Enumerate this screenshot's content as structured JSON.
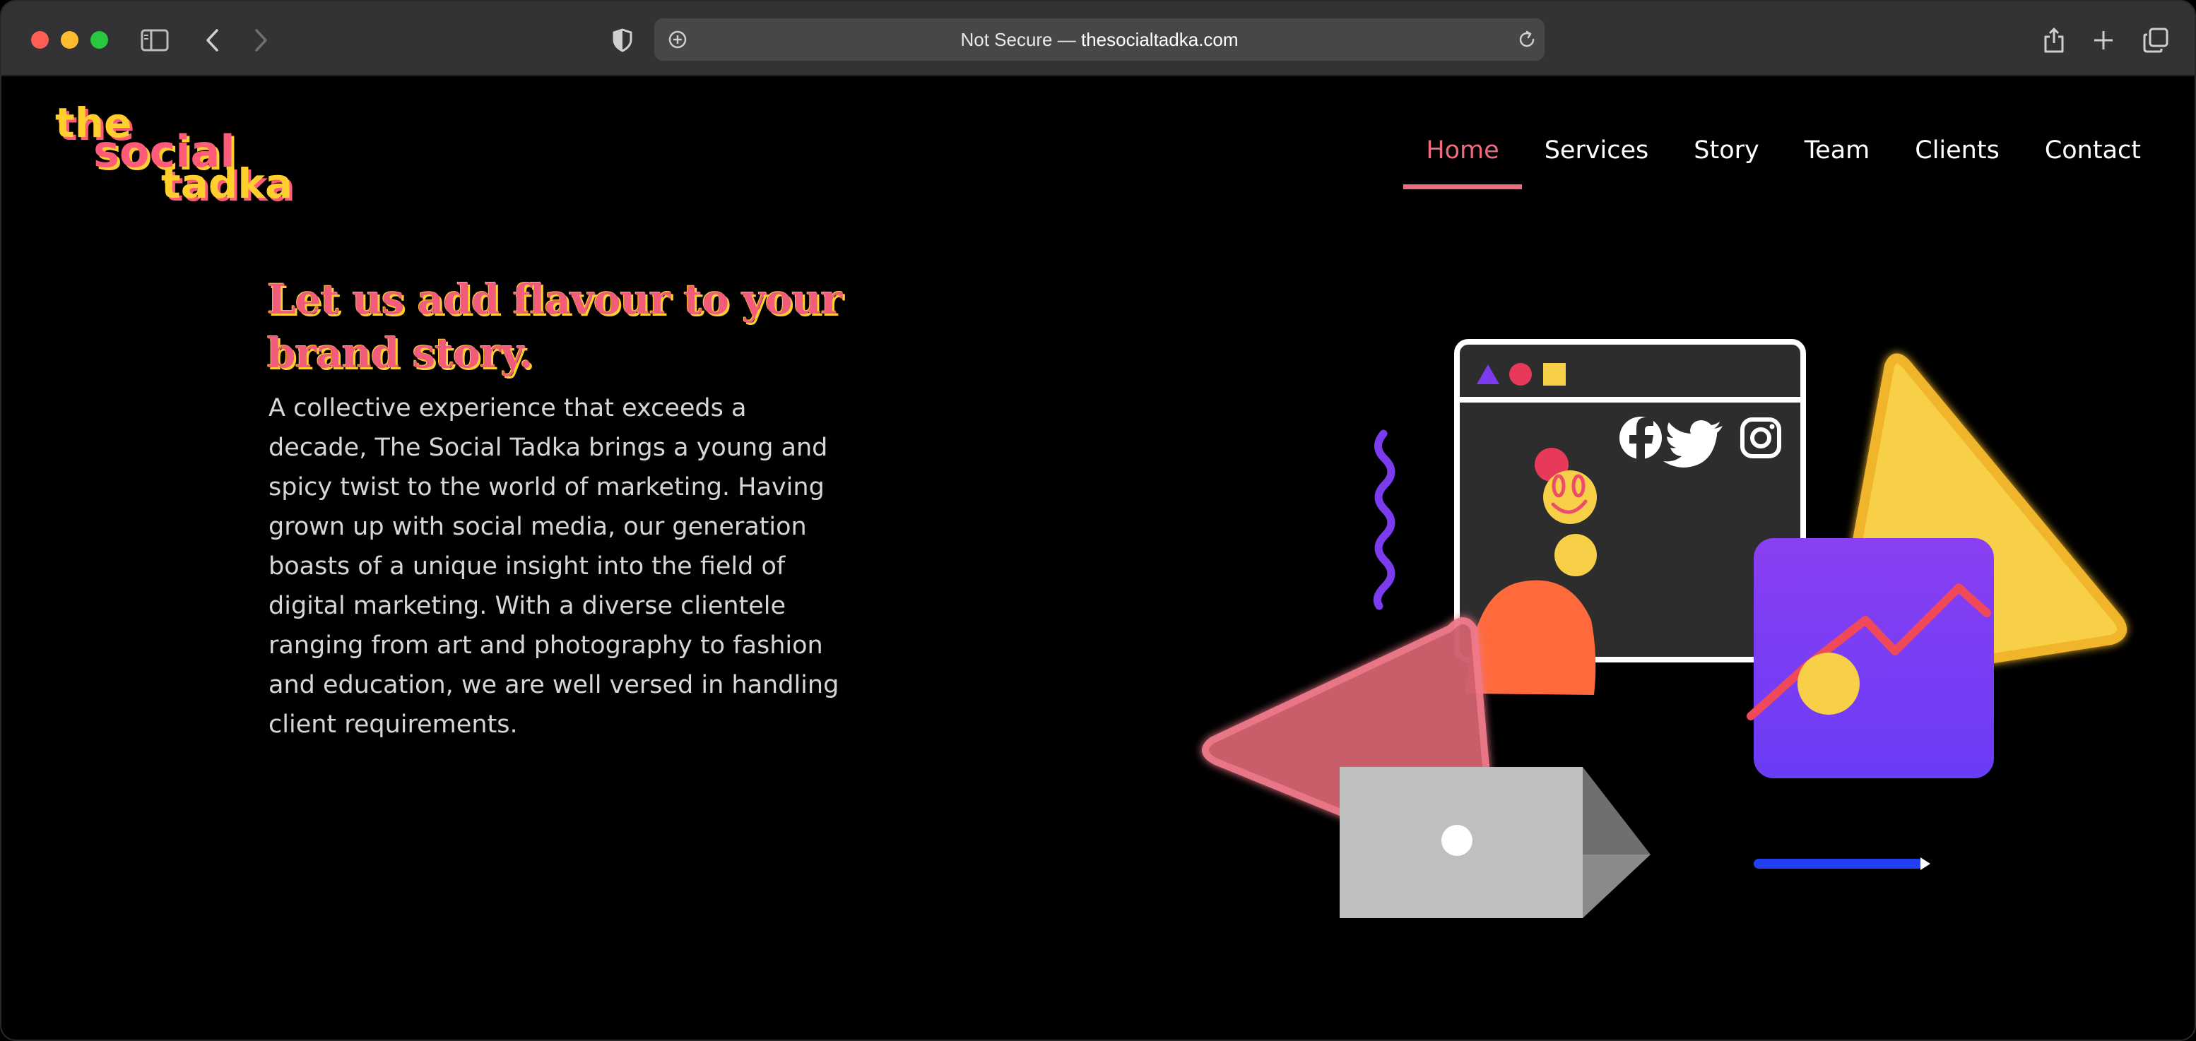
{
  "browser": {
    "url_prefix": "Not Secure — ",
    "url_domain": "thesocialtadka.com"
  },
  "logo": {
    "line1": "the",
    "line2": "social",
    "line3": "tadka"
  },
  "nav": {
    "items": [
      {
        "label": "Home",
        "active": true
      },
      {
        "label": "Services"
      },
      {
        "label": "Story"
      },
      {
        "label": "Team"
      },
      {
        "label": "Clients"
      },
      {
        "label": "Contact"
      }
    ]
  },
  "hero": {
    "title": "Let us add flavour to your brand story.",
    "body": "A collective experience that exceeds a decade, The Social Tadka brings a young and spicy twist to the world of marketing. Having grown up with social media, our generation boasts of a unique insight into the field of digital marketing. With a diverse clientele ranging from art and photography to fashion and education, we are well versed in handling client requirements."
  },
  "colors": {
    "accent_pink": "#ee6b7d",
    "accent_yellow": "#ffcf2e",
    "purple": "#7b3cf0"
  },
  "icons": [
    "facebook-icon",
    "twitter-icon",
    "instagram-icon",
    "sidebar-icon",
    "back-icon",
    "forward-icon",
    "shield-icon",
    "reload-icon",
    "share-icon",
    "new-tab-icon",
    "tabs-overview-icon"
  ]
}
